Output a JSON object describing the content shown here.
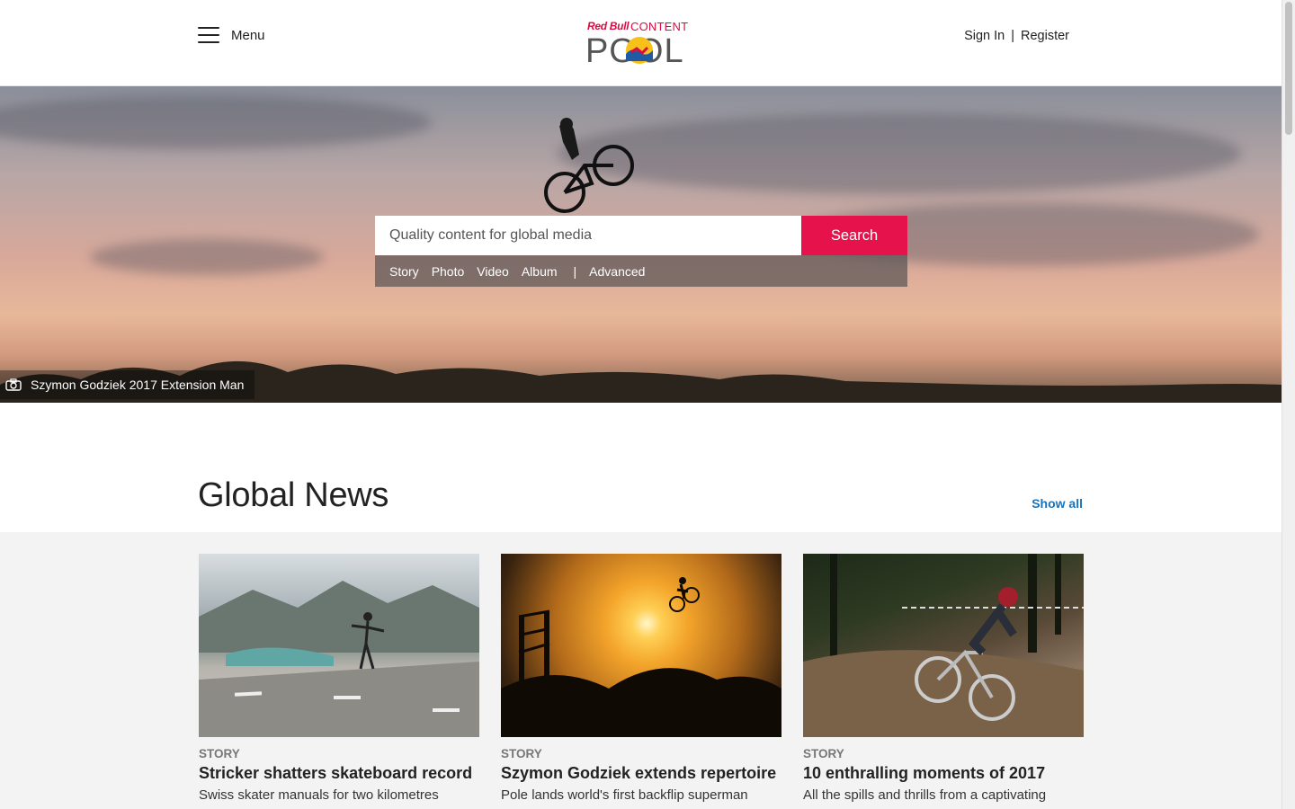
{
  "header": {
    "menu_label": "Menu",
    "logo": {
      "brand": "Red Bull",
      "content": "CONTENT",
      "pool": "POOL"
    },
    "sign_in": "Sign In",
    "separator": "|",
    "register": "Register"
  },
  "hero": {
    "search_placeholder": "Quality content for global media",
    "search_button": "Search",
    "filters": [
      "Story",
      "Photo",
      "Video",
      "Album"
    ],
    "divider": "|",
    "advanced": "Advanced",
    "caption": "Szymon Godziek 2017 Extension Man"
  },
  "news": {
    "title": "Global News",
    "show_all": "Show all",
    "cards": [
      {
        "kind": "STORY",
        "title": "Stricker shatters skateboard record",
        "subtitle": "Swiss skater manuals for two kilometres"
      },
      {
        "kind": "STORY",
        "title": "Szymon Godziek extends repertoire",
        "subtitle": "Pole lands world's first backflip superman"
      },
      {
        "kind": "STORY",
        "title": "10 enthralling moments of 2017",
        "subtitle": "All the spills and thrills from a captivating"
      }
    ]
  },
  "colors": {
    "accent": "#e5124c",
    "link": "#1a73b8",
    "brand_red": "#db0a40"
  },
  "icons": {
    "menu": "hamburger-icon",
    "caption": "camera-icon"
  }
}
